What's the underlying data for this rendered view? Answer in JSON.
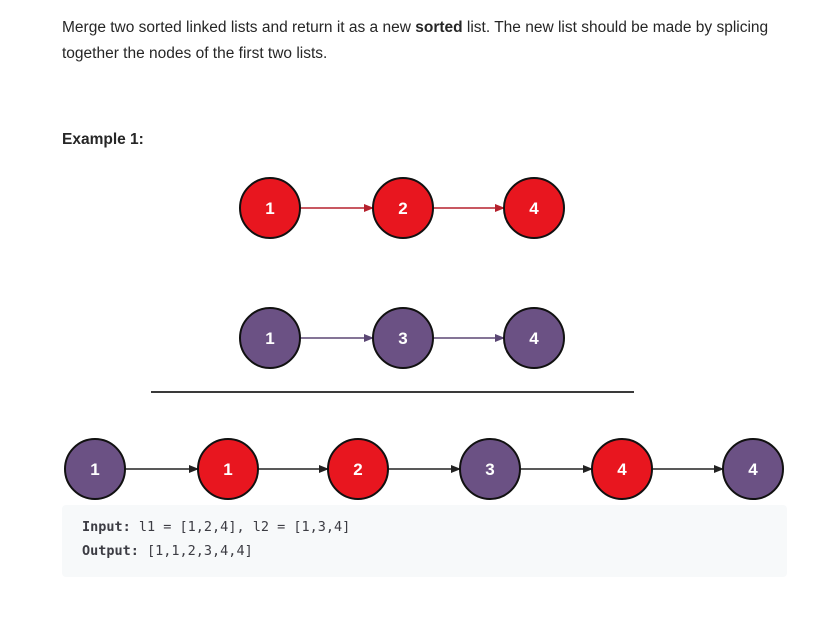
{
  "problem": {
    "desc_part1": "Merge two sorted linked lists and return it as a new ",
    "desc_bold": "sorted",
    "desc_part2": " list. The new list should be made by splicing together the nodes of the first two lists."
  },
  "example": {
    "title": "Example 1:",
    "input_label": "Input:",
    "input_value": " l1 = [1,2,4], l2 = [1,3,4]",
    "output_label": "Output:",
    "output_value": " [1,1,2,3,4,4]"
  },
  "colors": {
    "red": "#e8161f",
    "purple": "#6b5184",
    "red_arrow": "#b5212d",
    "purple_arrow": "#5b4774",
    "dark_arrow": "#222222"
  },
  "lists": {
    "l1": [
      {
        "value": "1",
        "color": "red"
      },
      {
        "value": "2",
        "color": "red"
      },
      {
        "value": "4",
        "color": "red"
      }
    ],
    "l2": [
      {
        "value": "1",
        "color": "purple"
      },
      {
        "value": "3",
        "color": "purple"
      },
      {
        "value": "4",
        "color": "purple"
      }
    ],
    "merged": [
      {
        "value": "1",
        "color": "purple"
      },
      {
        "value": "1",
        "color": "red"
      },
      {
        "value": "2",
        "color": "red"
      },
      {
        "value": "3",
        "color": "purple"
      },
      {
        "value": "4",
        "color": "red"
      },
      {
        "value": "4",
        "color": "purple"
      }
    ]
  }
}
